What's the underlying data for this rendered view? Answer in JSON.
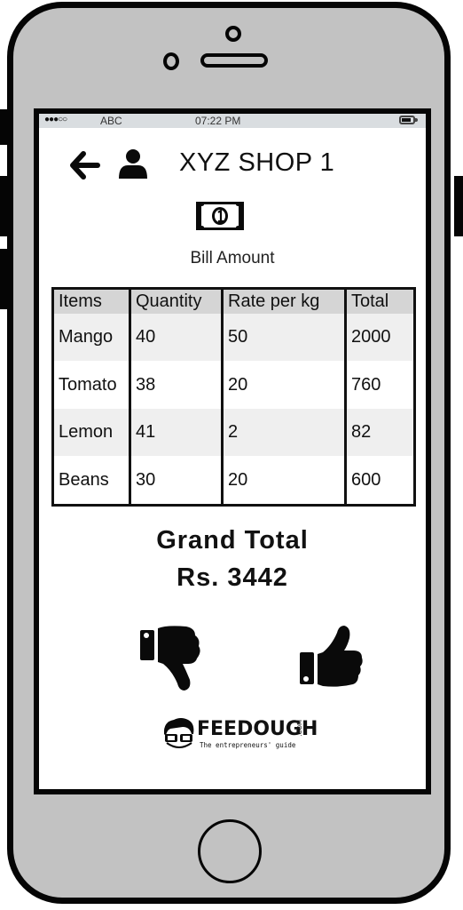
{
  "status_bar": {
    "signal": "●●●○○",
    "carrier": "ABC",
    "time": "07:22 PM",
    "battery_icon": "battery-icon"
  },
  "header": {
    "back_icon": "arrow-left-icon",
    "user_icon": "user-icon",
    "title": "XYZ SHOP 1"
  },
  "bill": {
    "icon": "money-bill-icon",
    "label": "Bill Amount"
  },
  "table": {
    "columns": [
      "Items",
      "Quantity",
      "Rate per kg",
      "Total"
    ],
    "rows": [
      [
        "Mango",
        "40",
        "50",
        "2000"
      ],
      [
        "Tomato",
        "38",
        "20",
        "760"
      ],
      [
        "Lemon",
        "41",
        "2",
        "82"
      ],
      [
        "Beans",
        "30",
        "20",
        "600"
      ]
    ]
  },
  "grand_total": {
    "label": "Grand Total",
    "value": "Rs. 3442"
  },
  "actions": {
    "reject_icon": "thumbs-down-icon",
    "approve_icon": "thumbs-up-icon"
  },
  "branding": {
    "name": "FEEDOUGH",
    "suffix": ".COM",
    "tagline": "The entrepreneurs' guide"
  }
}
